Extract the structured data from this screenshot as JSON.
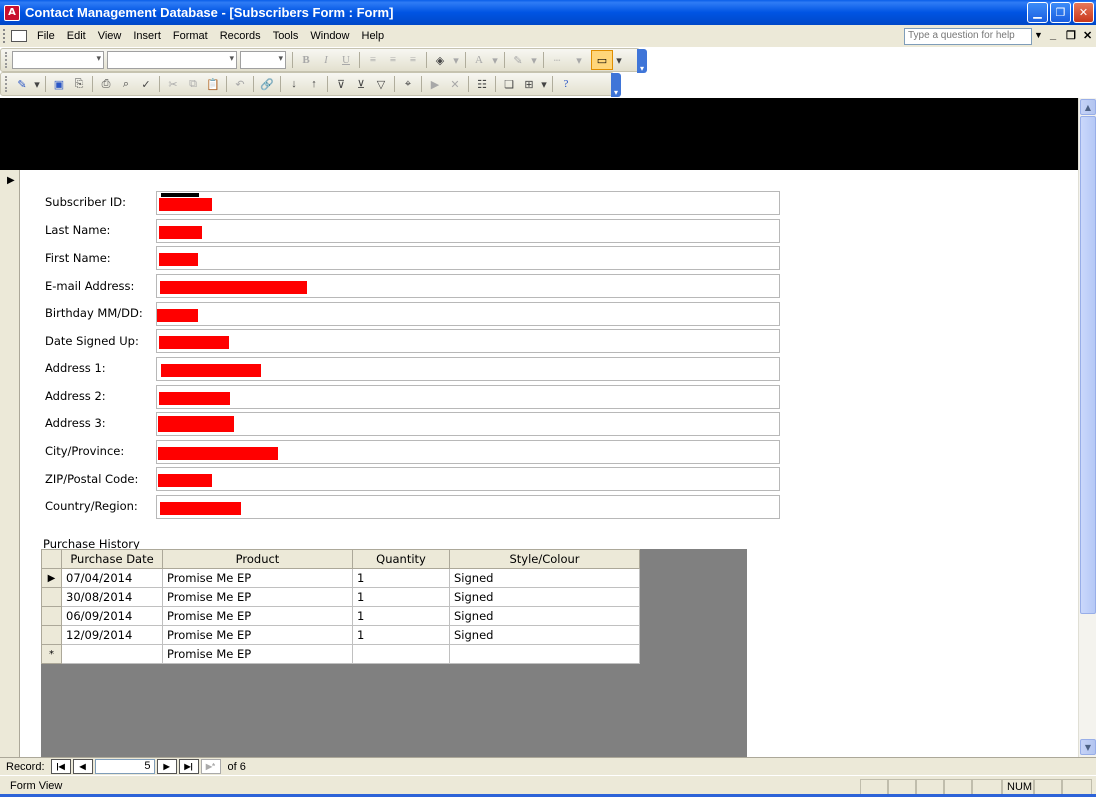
{
  "window": {
    "title": "Contact Management Database - [Subscribers Form : Form]",
    "app_icon": "access-icon"
  },
  "menu": {
    "items": [
      "File",
      "Edit",
      "View",
      "Insert",
      "Format",
      "Records",
      "Tools",
      "Window",
      "Help"
    ],
    "help_placeholder": "Type a question for help"
  },
  "form": {
    "fields": [
      {
        "label": "Subscriber ID:"
      },
      {
        "label": "Last Name:"
      },
      {
        "label": "First Name:"
      },
      {
        "label": "E-mail Address:"
      },
      {
        "label": "Birthday MM/DD:"
      },
      {
        "label": "Date Signed Up:"
      },
      {
        "label": "Address 1:"
      },
      {
        "label": "Address 2:"
      },
      {
        "label": "Address 3:"
      },
      {
        "label": "City/Province:"
      },
      {
        "label": "ZIP/Postal Code:"
      },
      {
        "label": "Country/Region:"
      }
    ],
    "redaction_color": "#ff0000"
  },
  "purchase_history": {
    "label": "Purchase History",
    "columns": [
      "Purchase Date",
      "Product",
      "Quantity",
      "Style/Colour"
    ],
    "rows": [
      {
        "date": "07/04/2014",
        "product": "Promise Me EP",
        "quantity": "1",
        "style": "Signed"
      },
      {
        "date": "30/08/2014",
        "product": "Promise Me EP",
        "quantity": "1",
        "style": "Signed"
      },
      {
        "date": "06/09/2014",
        "product": "Promise Me EP",
        "quantity": "1",
        "style": "Signed"
      },
      {
        "date": "12/09/2014",
        "product": "Promise Me EP",
        "quantity": "1",
        "style": "Signed"
      }
    ],
    "new_row": {
      "marker": "*",
      "product": "Promise Me EP"
    }
  },
  "navigation": {
    "record_label": "Record:",
    "current": "5",
    "of_text": "of 6"
  },
  "status": {
    "left": "Form View",
    "num": "NUM"
  }
}
